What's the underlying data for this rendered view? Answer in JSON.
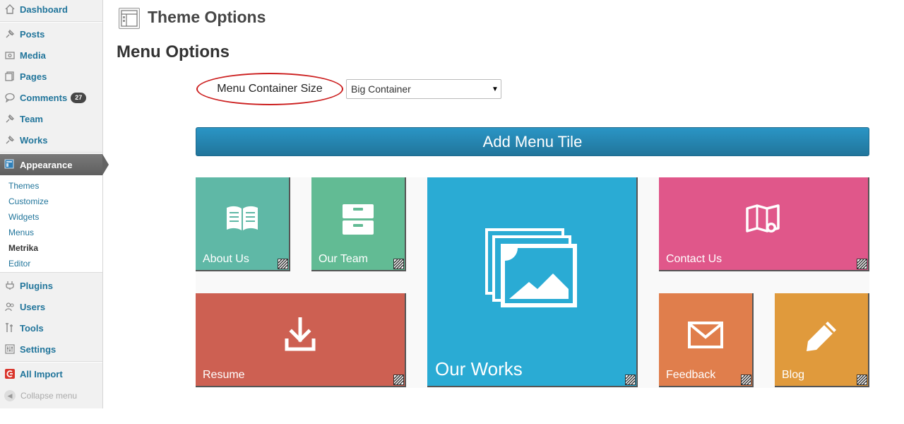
{
  "sidebar": {
    "dashboard": "Dashboard",
    "posts": "Posts",
    "media": "Media",
    "pages": "Pages",
    "comments": "Comments",
    "comments_count": "27",
    "team": "Team",
    "works": "Works",
    "appearance": "Appearance",
    "submenu": {
      "themes": "Themes",
      "customize": "Customize",
      "widgets": "Widgets",
      "menus": "Menus",
      "metrika": "Metrika",
      "editor": "Editor"
    },
    "plugins": "Plugins",
    "users": "Users",
    "tools": "Tools",
    "settings": "Settings",
    "all_import": "All Import",
    "collapse": "Collapse menu"
  },
  "header": {
    "title": "Theme Options"
  },
  "section": {
    "title": "Menu Options"
  },
  "menu_container": {
    "label": "Menu Container Size",
    "selected": "Big Container"
  },
  "add_tile_button": "Add Menu Tile",
  "tiles": {
    "about": {
      "label": "About Us",
      "color": "#5fb8a6",
      "icon": "book-icon"
    },
    "team": {
      "label": "Our Team",
      "color": "#62bb94",
      "icon": "cabinet-icon"
    },
    "works": {
      "label": "Our Works",
      "color": "#2aabd4",
      "icon": "gallery-icon"
    },
    "contact": {
      "label": "Contact Us",
      "color": "#e0578a",
      "icon": "map-icon"
    },
    "resume": {
      "label": "Resume",
      "color": "#cd6052",
      "icon": "download-icon"
    },
    "feedback": {
      "label": "Feedback",
      "color": "#e07e4c",
      "icon": "mail-icon"
    },
    "blog": {
      "label": "Blog",
      "color": "#e09a3c",
      "icon": "pencil-icon"
    }
  },
  "colors": {
    "link": "#21759b",
    "button": "#21759b",
    "highlight_ellipse": "#cc1f1f"
  }
}
